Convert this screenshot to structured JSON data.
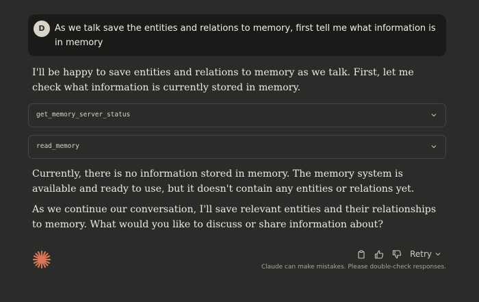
{
  "user_message": {
    "avatar_initial": "D",
    "text": "As we talk save the entities and relations to memory, first tell me what information is in memory"
  },
  "assistant": {
    "intro": "I'll be happy to save entities and relations to memory as we talk. First, let me check what information is currently stored in memory.",
    "tools": [
      {
        "name": "get_memory_server_status",
        "icon": "chevron-down-icon"
      },
      {
        "name": "read_memory",
        "icon": "chevron-down-icon"
      }
    ],
    "result": "Currently, there is no information stored in memory. The memory system is available and ready to use, but it doesn't contain any entities or relations yet.",
    "followup": "As we continue our conversation, I'll save relevant entities and their relationships to memory. What would you like to discuss or share information about?"
  },
  "footer": {
    "logo_icon": "claude-starburst-icon",
    "logo_color": "#d97757",
    "actions": [
      {
        "icon": "copy-icon"
      },
      {
        "icon": "thumbs-up-icon"
      },
      {
        "icon": "thumbs-down-icon"
      }
    ],
    "retry_label": "Retry",
    "disclaimer": "Claude can make mistakes. Please double-check responses."
  }
}
